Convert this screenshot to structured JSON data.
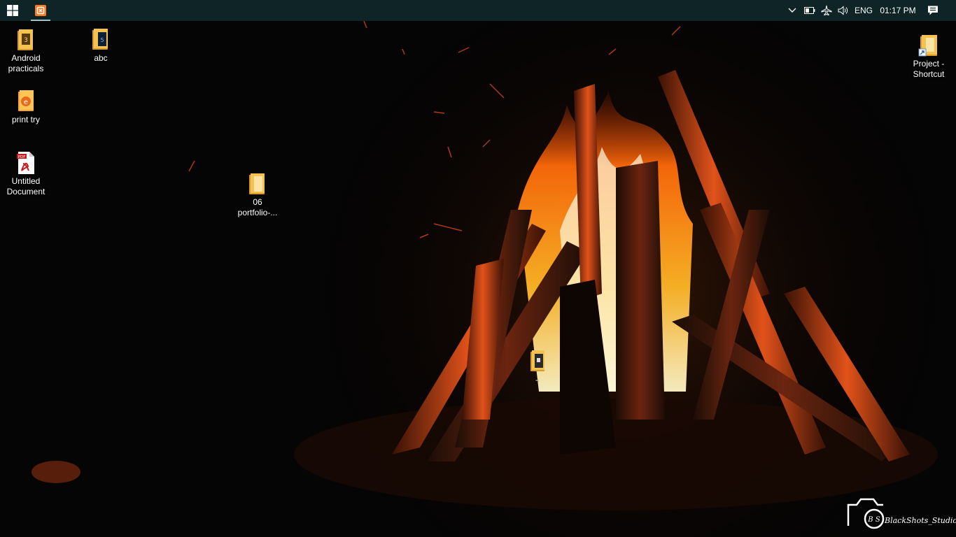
{
  "taskbar": {
    "pinned_apps": [
      {
        "name": "xampp-control-panel",
        "icon": "xampp-icon",
        "active": true
      }
    ],
    "tray": {
      "chevron_icon": "chevron-up-icon",
      "battery_icon": "battery-icon",
      "airplane_icon": "airplane-mode-icon",
      "volume_icon": "volume-icon",
      "language": "ENG",
      "clock": "01:17 PM",
      "notifications_icon": "action-center-icon"
    },
    "colors": {
      "background": "#0e2427",
      "accent": "#fb7a24"
    }
  },
  "desktop_icons": [
    {
      "label": "Android\npracticals",
      "icon": "folder-icon"
    },
    {
      "label": "abc",
      "icon": "folder-icon"
    },
    {
      "label": "print try",
      "icon": "file-icon"
    },
    {
      "label": "Untitled\nDocument",
      "icon": "pdf-icon"
    },
    {
      "label": "06\nportfolio-...",
      "icon": "folder-icon"
    },
    {
      "label": "-",
      "icon": "folder-icon"
    },
    {
      "label": "Project -\nShortcut",
      "icon": "folder-shortcut-icon"
    }
  ],
  "watermark": {
    "initials": "B S",
    "text": "BlackShots_Studio"
  }
}
